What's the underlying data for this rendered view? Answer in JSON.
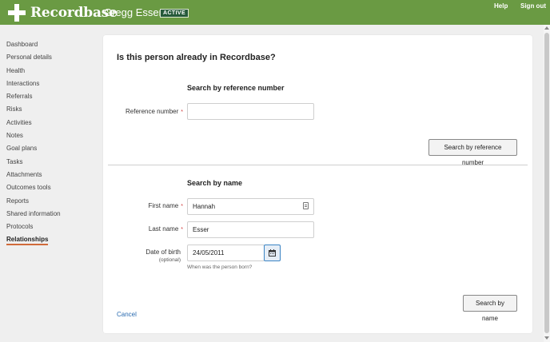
{
  "header": {
    "logo_text": "Recordbase",
    "person_name": "Gregg Esser",
    "status_badge": "ACTIVE",
    "help_label": "Help",
    "signout_label": "Sign out"
  },
  "sidebar": {
    "items": [
      {
        "label": "Dashboard"
      },
      {
        "label": "Personal details"
      },
      {
        "label": "Health"
      },
      {
        "label": "Interactions"
      },
      {
        "label": "Referrals"
      },
      {
        "label": "Risks"
      },
      {
        "label": "Activities"
      },
      {
        "label": "Notes"
      },
      {
        "label": "Goal plans"
      },
      {
        "label": "Tasks"
      },
      {
        "label": "Attachments"
      },
      {
        "label": "Outcomes tools"
      },
      {
        "label": "Reports"
      },
      {
        "label": "Shared information"
      },
      {
        "label": "Protocols"
      },
      {
        "label": "Relationships",
        "active": true
      }
    ]
  },
  "main": {
    "title": "Is this person already in Recordbase?",
    "ref_section": {
      "title": "Search by reference number",
      "ref_label": "Reference number",
      "ref_value": "",
      "button_label": "Search by reference number"
    },
    "name_section": {
      "title": "Search by name",
      "first_name_label": "First name",
      "first_name_value": "Hannah",
      "last_name_label": "Last name",
      "last_name_value": "Esser",
      "dob_label": "Date of birth",
      "dob_optional": "(optional)",
      "dob_value": "24/05/2011",
      "dob_hint": "When was the person born?",
      "button_label": "Search by name"
    },
    "required_marker": "*",
    "cancel_label": "Cancel"
  },
  "icons": {
    "logo": "recordbase-cross-icon",
    "calendar": "calendar-icon",
    "field_helper": "password-manager-icon"
  },
  "colors": {
    "topbar": "#6a9a43",
    "badge": "#25593a",
    "active_underline": "#d06a3a",
    "link": "#2a6bb0",
    "required": "#d03a3a"
  }
}
